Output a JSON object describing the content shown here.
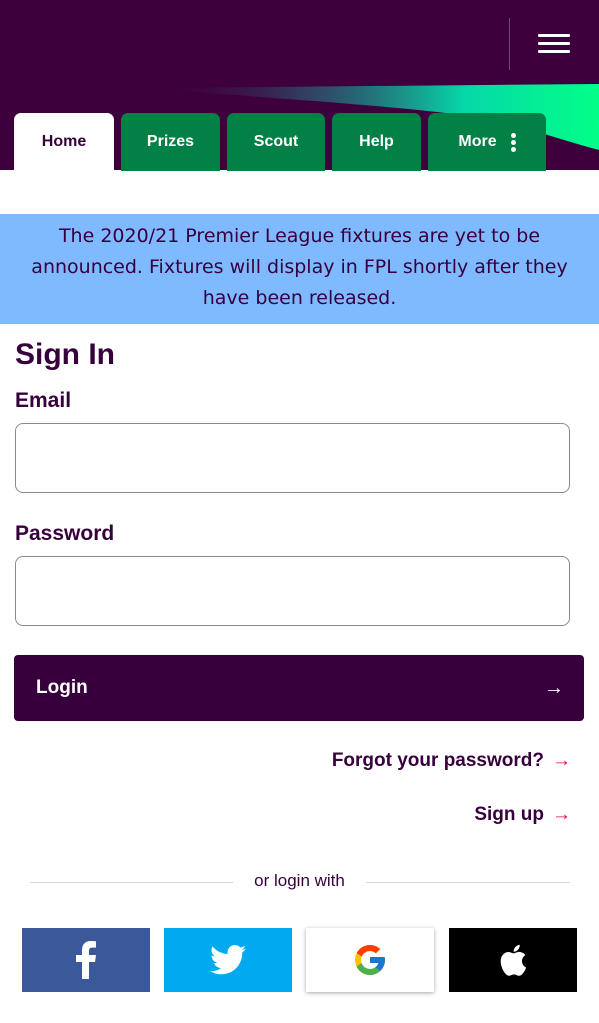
{
  "header": {
    "menu_icon": "hamburger-icon"
  },
  "tabs": [
    {
      "label": "Home",
      "active": true
    },
    {
      "label": "Prizes",
      "active": false
    },
    {
      "label": "Scout",
      "active": false
    },
    {
      "label": "Help",
      "active": false
    },
    {
      "label": "More",
      "active": false,
      "icon": "vertical-dots-icon"
    }
  ],
  "notice": {
    "text": "The 2020/21 Premier League fixtures are yet to be announced. Fixtures will display in FPL shortly after they have been released."
  },
  "form": {
    "title": "Sign In",
    "email_label": "Email",
    "email_value": "",
    "password_label": "Password",
    "password_value": "",
    "login_label": "Login",
    "login_arrow": "→"
  },
  "links": {
    "forgot_label": "Forgot your password?",
    "signup_label": "Sign up",
    "arrow": "→"
  },
  "social": {
    "divider_text": "or login with",
    "providers": [
      "facebook",
      "twitter",
      "google",
      "apple"
    ]
  },
  "colors": {
    "header_purple": "#3d003d",
    "tab_green": "#028045",
    "notice_blue": "#7fb9ff",
    "brand_purple": "#37003c",
    "accent_pink": "#e90052",
    "facebook_blue": "#3b5998",
    "twitter_blue": "#00a9f0"
  }
}
